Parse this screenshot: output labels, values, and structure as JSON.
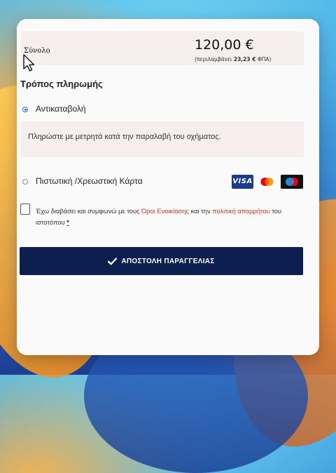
{
  "order_total": {
    "label": "Σύνολο",
    "amount": "120,00 €",
    "vat_prefix": "(περιλαμβάνει",
    "vat_amount": "23,23 €",
    "vat_suffix": "ΦΠΑ)"
  },
  "payment": {
    "title": "Τρόπος πληρωμής",
    "options": [
      {
        "label": "Αντικαταβολή",
        "selected": true,
        "description": "Πληρώστε με μετρητά κατά την παραλαβή του οχήματος."
      },
      {
        "label": "Πιστωτική /Χρεωστική Κάρτα",
        "selected": false,
        "logos": [
          "visa-logo",
          "mastercard-logo",
          "maestro-logo"
        ],
        "visa_text": "VISA"
      }
    ]
  },
  "terms": {
    "prefix": "Έχω διαβάσει και συμφωνώ με τους",
    "terms_link": "Όροι Ενοικίασης",
    "middle": "και την",
    "policy_link": "πολιτική απορρήτου",
    "suffix": "του ιστοτόπου",
    "required_mark": "*"
  },
  "submit": {
    "label": "ΑΠΟΣΤΟΛΗ ΠΑΡΑΓΓΕΛΙΑΣ",
    "icon": "check-icon"
  },
  "colors": {
    "button_bg": "#0c1f4e",
    "link": "#c8341f",
    "highlight_bg": "#f6eded",
    "radio_accent": "#2a6fe0"
  }
}
